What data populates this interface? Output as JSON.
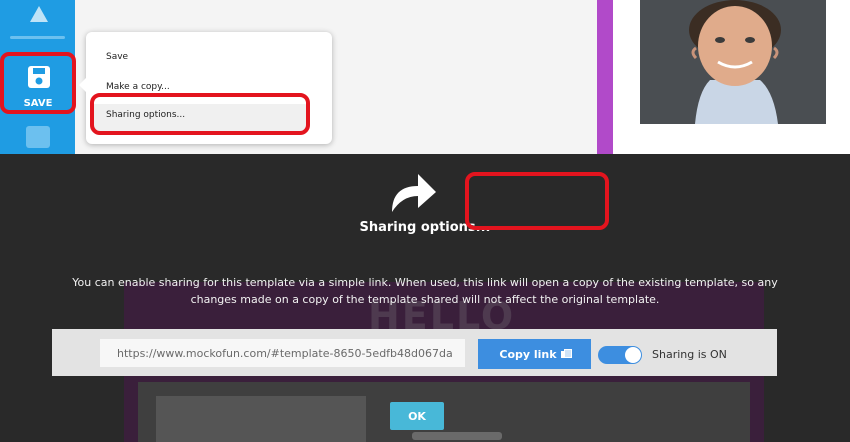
{
  "sidebar": {
    "save_label": "SAVE"
  },
  "context_menu": {
    "items": [
      {
        "label": "Save"
      },
      {
        "label": "Make a copy..."
      },
      {
        "label": "Sharing options..."
      }
    ]
  },
  "modal": {
    "title": "Sharing options...",
    "description": "You can enable sharing for this template via a simple link. When used, this link will open a copy of the existing template, so any changes made on a copy of the template shared will not affect the original template.",
    "link_value": "https://www.mockofun.com/#template-8650-5edfb48d067da",
    "copy_button": "Copy link",
    "toggle_on": true,
    "toggle_label": "Sharing is ON",
    "ok_button": "OK"
  },
  "background": {
    "heading": "HELLO"
  },
  "colors": {
    "sidebar": "#1f9ce3",
    "highlight": "#e3141e",
    "accent": "#3d8ee0",
    "ok": "#48b8d8",
    "purple": "#b14ac9"
  },
  "icons": [
    "share-arrow-icon",
    "floppy-disk-icon",
    "copy-icon"
  ]
}
